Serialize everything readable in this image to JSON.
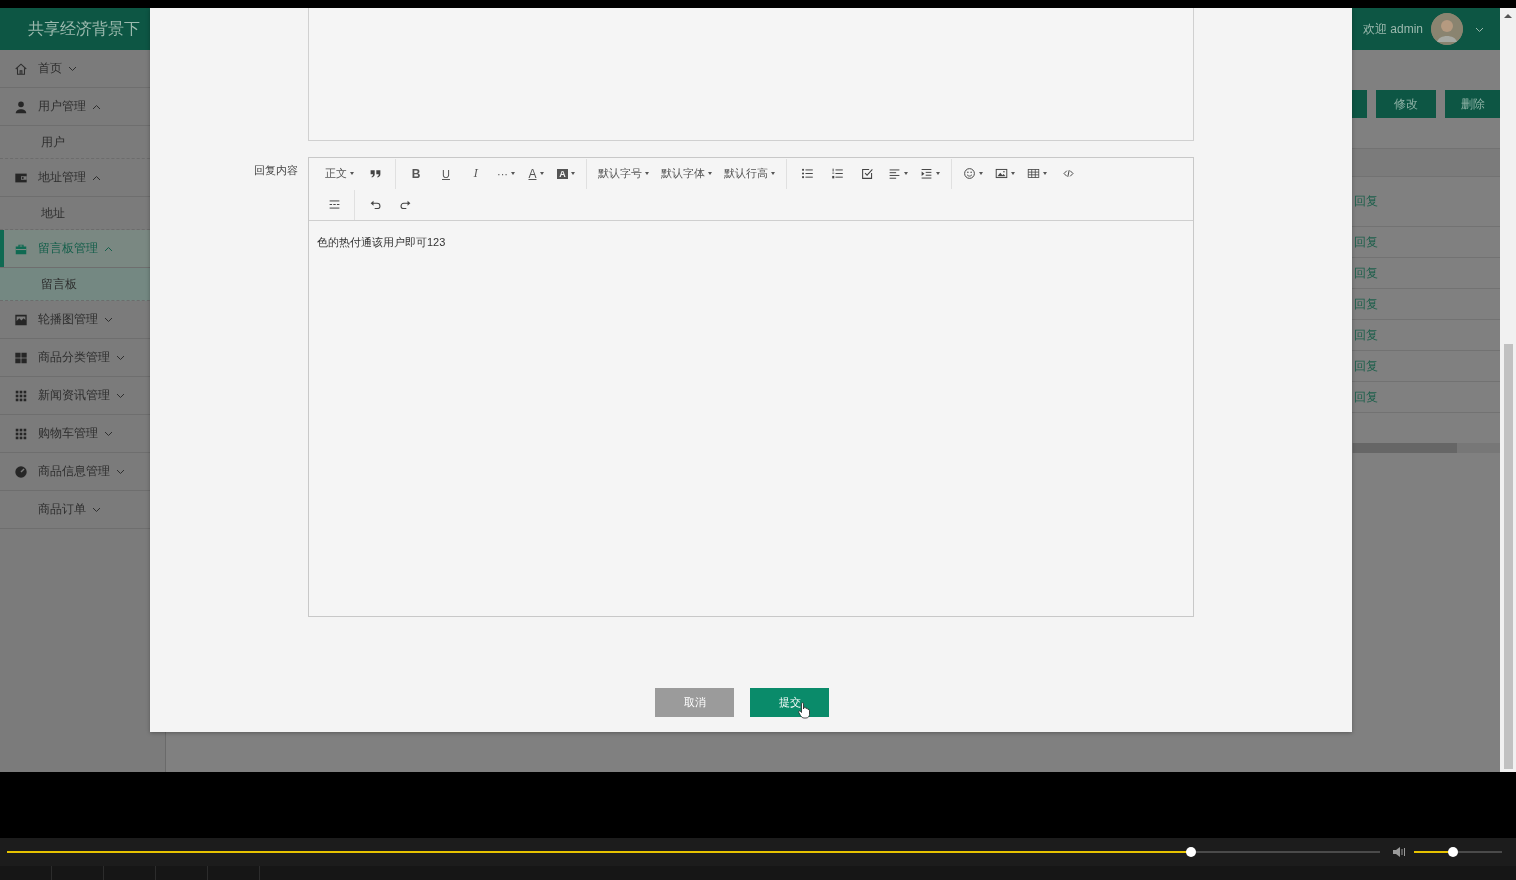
{
  "header": {
    "title": "共享经济背景下",
    "welcome": "欢迎 admin"
  },
  "sidebar": {
    "items": [
      {
        "label": "首页",
        "expanded": false,
        "selected": false
      },
      {
        "label": "用户管理",
        "expanded": true,
        "selected": false,
        "children": [
          {
            "label": "用户",
            "selected": false
          }
        ]
      },
      {
        "label": "地址管理",
        "expanded": true,
        "selected": false,
        "children": [
          {
            "label": "地址",
            "selected": false
          }
        ]
      },
      {
        "label": "留言板管理",
        "expanded": true,
        "selected": true,
        "children": [
          {
            "label": "留言板",
            "selected": true
          }
        ]
      },
      {
        "label": "轮播图管理",
        "expanded": false,
        "selected": false
      },
      {
        "label": "商品分类管理",
        "expanded": false,
        "selected": false
      },
      {
        "label": "新闻资讯管理",
        "expanded": false,
        "selected": false
      },
      {
        "label": "购物车管理",
        "expanded": false,
        "selected": false
      },
      {
        "label": "商品信息管理",
        "expanded": false,
        "selected": false
      },
      {
        "label": "商品订单",
        "expanded": false,
        "selected": false
      }
    ]
  },
  "main": {
    "buttons": [
      "修改",
      "删除"
    ],
    "rows": [
      {
        "action": "回复"
      },
      {
        "action": "回复"
      },
      {
        "action": "回复"
      },
      {
        "action": "回复"
      },
      {
        "action": "回复"
      },
      {
        "action": "回复"
      },
      {
        "action": "回复"
      }
    ]
  },
  "modal": {
    "reply_label": "回复内容",
    "editor": {
      "toolbar": {
        "rows": [
          [
            [
              {
                "kind": "select",
                "label": "正文",
                "dropdown": true
              },
              {
                "kind": "icon",
                "dropdown": false
              }
            ],
            [
              {
                "kind": "bold",
                "label": "B",
                "dropdown": false
              },
              {
                "kind": "underline",
                "label": "U",
                "dropdown": false
              },
              {
                "kind": "italic",
                "label": "I",
                "dropdown": false
              },
              {
                "kind": "more",
                "label": "···",
                "dropdown": true
              },
              {
                "kind": "forecolor",
                "label": "A",
                "dropdown": true
              },
              {
                "kind": "backcolor",
                "label": "A",
                "dropdown": true
              }
            ],
            [
              {
                "kind": "select",
                "label": "默认字号",
                "dropdown": true
              },
              {
                "kind": "select",
                "label": "默认字体",
                "dropdown": true
              },
              {
                "kind": "select",
                "label": "默认行高",
                "dropdown": true
              }
            ],
            [
              {
                "kind": "icon",
                "dropdown": false
              },
              {
                "kind": "icon",
                "dropdown": false
              },
              {
                "kind": "icon",
                "dropdown": false
              },
              {
                "kind": "icon",
                "dropdown": true
              },
              {
                "kind": "icon",
                "dropdown": true
              }
            ],
            [
              {
                "kind": "icon",
                "dropdown": true
              },
              {
                "kind": "icon",
                "dropdown": true
              },
              {
                "kind": "icon",
                "dropdown": true
              },
              {
                "kind": "icon",
                "dropdown": false
              }
            ]
          ],
          [
            [
              {
                "kind": "icon",
                "dropdown": false
              }
            ],
            [
              {
                "kind": "icon",
                "dropdown": false
              },
              {
                "kind": "icon",
                "dropdown": false
              }
            ]
          ]
        ]
      },
      "content": "色的热付通该用户即可123"
    },
    "buttons": [
      {
        "label": "取消",
        "kind": "cancel"
      },
      {
        "label": "提交",
        "kind": "submit"
      }
    ]
  },
  "player": {
    "progress": {
      "level": 0.862
    },
    "volume": {
      "level": 0.44
    }
  }
}
